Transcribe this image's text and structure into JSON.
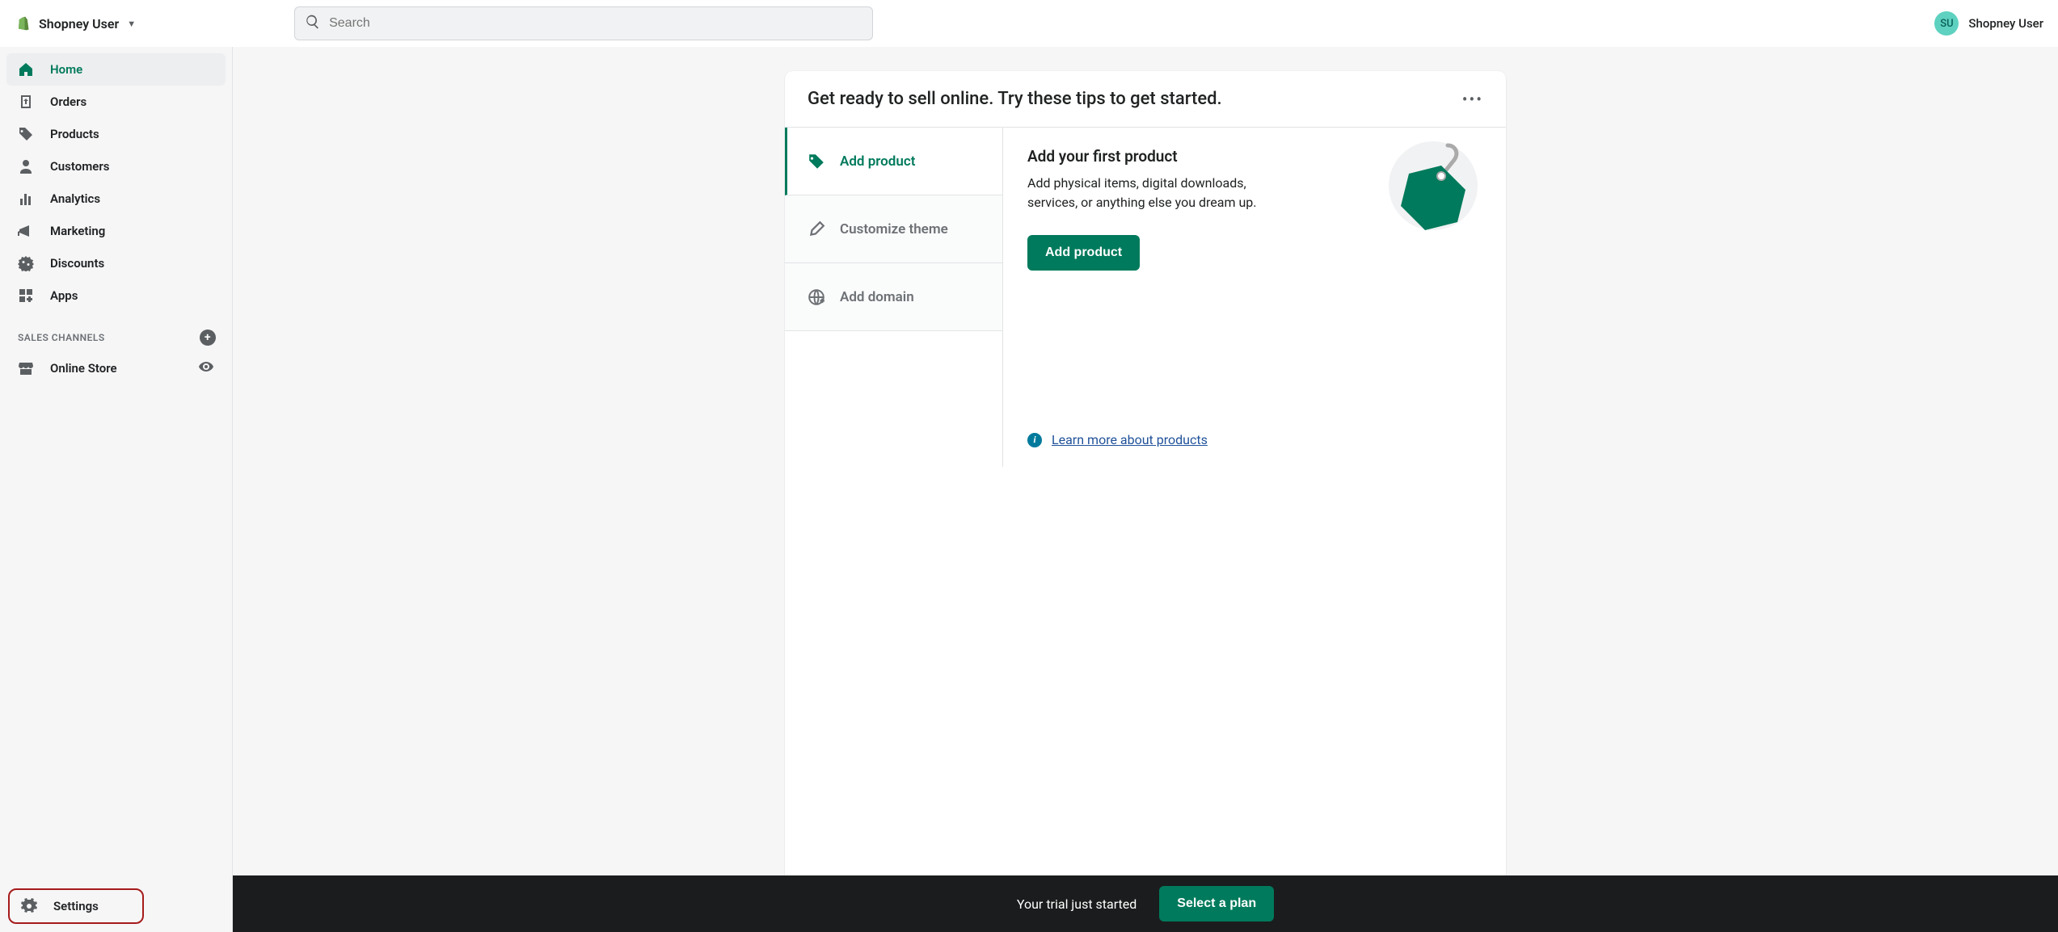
{
  "header": {
    "store_name": "Shopney User",
    "search_placeholder": "Search",
    "user_initials": "SU",
    "user_name": "Shopney User"
  },
  "sidebar": {
    "items": [
      {
        "label": "Home"
      },
      {
        "label": "Orders"
      },
      {
        "label": "Products"
      },
      {
        "label": "Customers"
      },
      {
        "label": "Analytics"
      },
      {
        "label": "Marketing"
      },
      {
        "label": "Discounts"
      },
      {
        "label": "Apps"
      }
    ],
    "channels_header": "SALES CHANNELS",
    "channels": [
      {
        "label": "Online Store"
      }
    ],
    "settings_label": "Settings"
  },
  "card": {
    "title": "Get ready to sell online. Try these tips to get started.",
    "steps": [
      {
        "label": "Add product"
      },
      {
        "label": "Customize theme"
      },
      {
        "label": "Add domain"
      }
    ],
    "detail": {
      "heading": "Add your first product",
      "body": "Add physical items, digital downloads, services, or anything else you dream up.",
      "button": "Add product",
      "learn_more": "Learn more about products"
    }
  },
  "trial": {
    "message": "Your trial just started",
    "button": "Select a plan"
  }
}
